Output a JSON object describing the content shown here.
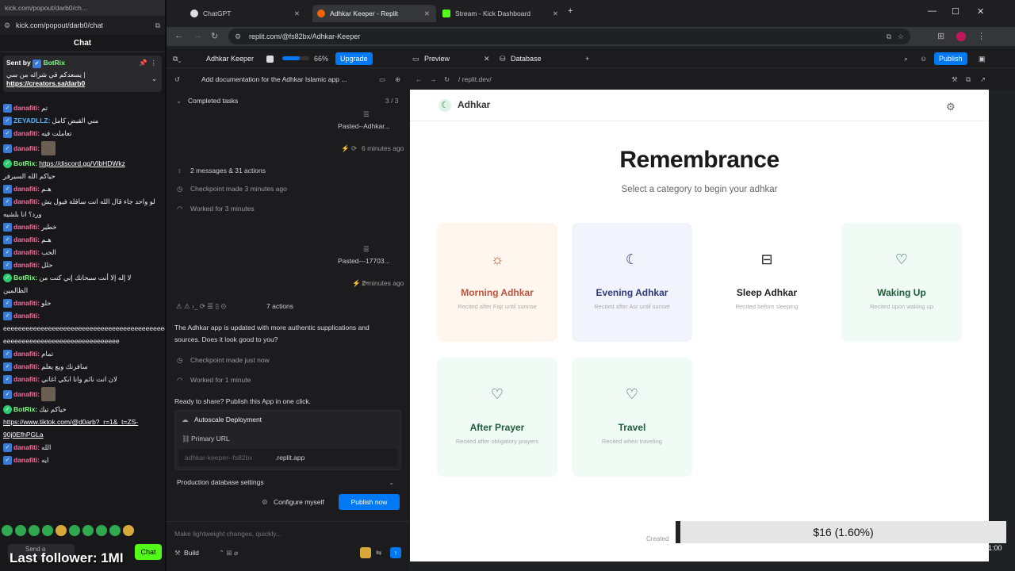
{
  "chat_window": {
    "url": "kick.com/popout/darb0/ch...",
    "address": "kick.com/popout/darb0/chat",
    "title": "Chat",
    "pinned": {
      "sent_by": "Sent by",
      "bot_name": "BotRix",
      "arabic": "| يسعدكم في شرائه من سي",
      "link": "https://creators.sa/darb0"
    },
    "messages": [
      {
        "user": "danafiti:",
        "text": "تم"
      },
      {
        "user": "ZEYADLLZ:",
        "text": "مني القبض كامل",
        "kind": "blue"
      },
      {
        "user": "danafiti:",
        "text": "تعاملت فيه"
      },
      {
        "user": "danafiti:",
        "text": "",
        "thumb": true
      },
      {
        "user": "BotRix:",
        "text": "",
        "link": "https://discord.gg/VIbHDWkz",
        "kind": "bot"
      },
      {
        "user": "",
        "text": "حياكم الله السيرفر"
      },
      {
        "user": "danafiti:",
        "text": "هـم"
      },
      {
        "user": "danafiti:",
        "text": "لو واحد جاء قال الله انت سافلة فيول يش"
      },
      {
        "user": "",
        "text": "ورد؟ انا بلشيه"
      },
      {
        "user": "danafiti:",
        "text": "خطير"
      },
      {
        "user": "danafiti:",
        "text": "هـم"
      },
      {
        "user": "danafiti:",
        "text": "الحب"
      },
      {
        "user": "danafiti:",
        "text": "حلل"
      },
      {
        "user": "BotRix:",
        "text": "لا إله إلا أنت سبحانك إني كنت من",
        "kind": "bot"
      },
      {
        "user": "",
        "text": "الظالمين"
      },
      {
        "user": "danafiti:",
        "text": "حلو"
      },
      {
        "user": "danafiti:",
        "text": ""
      },
      {
        "user": "",
        "text": "eeeeeeeeeeeeeeeeeeeeeeeeeeeeeeeeeeeeeeeeeeee"
      },
      {
        "user": "",
        "text": "eeeeeeeeeeeeeeeeeeeeeeeeeeeeeee"
      },
      {
        "user": "danafiti:",
        "text": "تمام"
      },
      {
        "user": "danafiti:",
        "text": "سافرنك ويع يعلم"
      },
      {
        "user": "danafiti:",
        "text": "لان انت نائم وانا ابكي اغاني"
      },
      {
        "user": "danafiti:",
        "text": "",
        "thumb": true
      },
      {
        "user": "BotRix:",
        "text": "حياكم تيك",
        "kind": "bot"
      },
      {
        "user": "",
        "text": "",
        "link": "https://www.tiktok.com/@d0arb?_r=1&_t=ZS-"
      },
      {
        "user": "",
        "text": "",
        "link": "90j0EfhPGLa"
      },
      {
        "user": "danafiti:",
        "text": "الله"
      },
      {
        "user": "danafiti:",
        "text": "ايه"
      }
    ],
    "send_placeholder": "Send a",
    "chat_button": "Chat",
    "follower_text": "Last follower: 1MI"
  },
  "browser": {
    "tabs": [
      {
        "label": "ChatGPT",
        "color": "#dddddd"
      },
      {
        "label": "Adhkar Keeper - Replit",
        "color": "#f26207",
        "active": true
      },
      {
        "label": "Stream - Kick Dashboard",
        "color": "#53fc18"
      }
    ],
    "url": "replit.com/@fs82bx/Adhkar-Keeper"
  },
  "replit": {
    "project": "Adhkar Keeper",
    "usage": "66%",
    "usage_fraction": 0.66,
    "upgrade": "Upgrade",
    "preview_tab": "Preview",
    "database_tab": "Database",
    "publish": "Publish",
    "agent": {
      "title": "Add documentation for the Adhkar Islamic app ...",
      "completed": "Completed tasks",
      "completed_count": "3 / 3",
      "pasted1": "Pasted--Adhkar...",
      "time1": "6 minutes ago",
      "messages": "2 messages & 31 actions",
      "checkpoint1": "Checkpoint made 3 minutes ago",
      "worked1": "Worked for 3 minutes",
      "pasted2": "Pasted---17703...",
      "time2": "2 minutes ago",
      "actions": "7 actions",
      "summary1": "The Adhkar app is updated with more authentic supplications and",
      "summary2": "sources. Does it look good to you?",
      "checkpoint2": "Checkpoint made just now",
      "worked2": "Worked for 1 minute",
      "ready": "Ready to share? Publish this App in one click.",
      "autoscale": "Autoscale Deployment",
      "primary_url": "Primary URL",
      "url_prefix": "adhkar-keeper--fs82bx",
      "url_suffix": ".replit.app",
      "db_settings": "Production database settings",
      "configure": "Configure myself",
      "publish_now": "Publish now",
      "input_placeholder": "Make lightweight changes, quickly...",
      "build": "Build"
    },
    "preview_url": "/ replit.dev/"
  },
  "app": {
    "brand": "Adhkar",
    "hero": "Remembrance",
    "subtitle": "Select a category to begin your adhkar",
    "cards": [
      {
        "title": "Morning Adhkar",
        "sub": "Recited after Fajr until sunrise",
        "icon": "sun-icon",
        "bg": "#fff7ee",
        "fg": "#c0513f",
        "glyph": "☼"
      },
      {
        "title": "Evening Adhkar",
        "sub": "Recited after Asr until sunset",
        "icon": "moon-icon",
        "bg": "#f1f3fd",
        "fg": "#2f3a7a",
        "glyph": "☾"
      },
      {
        "title": "Sleep Adhkar",
        "sub": "Recited before sleeping",
        "icon": "bed-icon",
        "bg": "#ffffff",
        "fg": "#222222",
        "glyph": "⊟"
      },
      {
        "title": "Waking Up",
        "sub": "Recited upon waking up",
        "icon": "heart-icon",
        "bg": "#effbf4",
        "fg": "#1f5c3a",
        "glyph": "♡"
      },
      {
        "title": "After Prayer",
        "sub": "Recited after obligatory prayers",
        "icon": "heart-icon",
        "bg": "#effbf4",
        "fg": "#1f5c3a",
        "glyph": "♡"
      },
      {
        "title": "Travel",
        "sub": "Recited when traveling",
        "icon": "heart-icon",
        "bg": "#effbf4",
        "fg": "#1f5c3a",
        "glyph": "♡"
      }
    ],
    "footer": "Created"
  },
  "overlay": {
    "donation": "$16 (1.60%)",
    "clock": "1:00"
  }
}
